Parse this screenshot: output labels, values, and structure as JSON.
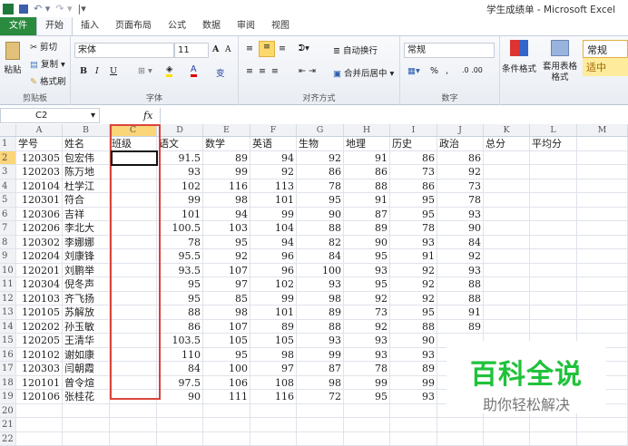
{
  "window": {
    "title": "学生成绩单 - Microsoft Excel"
  },
  "tabs": [
    "文件",
    "开始",
    "插入",
    "页面布局",
    "公式",
    "数据",
    "审阅",
    "视图"
  ],
  "ribbon": {
    "clipboard": {
      "paste": "粘贴",
      "cut": "剪切",
      "copy": "复制",
      "format_painter": "格式刷",
      "label": "剪贴板"
    },
    "font": {
      "name": "宋体",
      "size": "11",
      "bold": "B",
      "italic": "I",
      "underline": "U",
      "label": "字体",
      "grow": "A",
      "shrink": "A",
      "phonetic": "变"
    },
    "alignment": {
      "wrap": "自动换行",
      "merge": "合并后居中",
      "label": "对齐方式"
    },
    "number": {
      "format": "常规",
      "percent": "%",
      "comma": ",",
      "label": "数字"
    },
    "styles": {
      "conditional": "条件格式",
      "table": "套用表格格式",
      "normal": "常规",
      "neutral": "适中"
    }
  },
  "formula_bar": {
    "name_box": "C2",
    "fx": "fx",
    "value": ""
  },
  "columns": [
    "A",
    "B",
    "C",
    "D",
    "E",
    "F",
    "G",
    "H",
    "I",
    "J",
    "K",
    "L",
    "M"
  ],
  "headers": [
    "学号",
    "姓名",
    "班级",
    "语文",
    "数学",
    "英语",
    "生物",
    "地理",
    "历史",
    "政治",
    "总分",
    "平均分",
    ""
  ],
  "rows": [
    [
      "120305",
      "包宏伟",
      "",
      "91.5",
      "89",
      "94",
      "92",
      "91",
      "86",
      "86"
    ],
    [
      "120203",
      "陈万地",
      "",
      "93",
      "99",
      "92",
      "86",
      "86",
      "73",
      "92"
    ],
    [
      "120104",
      "杜学江",
      "",
      "102",
      "116",
      "113",
      "78",
      "88",
      "86",
      "73"
    ],
    [
      "120301",
      "符合",
      "",
      "99",
      "98",
      "101",
      "95",
      "91",
      "95",
      "78"
    ],
    [
      "120306",
      "吉祥",
      "",
      "101",
      "94",
      "99",
      "90",
      "87",
      "95",
      "93"
    ],
    [
      "120206",
      "李北大",
      "",
      "100.5",
      "103",
      "104",
      "88",
      "89",
      "78",
      "90"
    ],
    [
      "120302",
      "李娜娜",
      "",
      "78",
      "95",
      "94",
      "82",
      "90",
      "93",
      "84"
    ],
    [
      "120204",
      "刘康锋",
      "",
      "95.5",
      "92",
      "96",
      "84",
      "95",
      "91",
      "92"
    ],
    [
      "120201",
      "刘鹏举",
      "",
      "93.5",
      "107",
      "96",
      "100",
      "93",
      "92",
      "93"
    ],
    [
      "120304",
      "倪冬声",
      "",
      "95",
      "97",
      "102",
      "93",
      "95",
      "92",
      "88"
    ],
    [
      "120103",
      "齐飞扬",
      "",
      "95",
      "85",
      "99",
      "98",
      "92",
      "92",
      "88"
    ],
    [
      "120105",
      "苏解放",
      "",
      "88",
      "98",
      "101",
      "89",
      "73",
      "95",
      "91"
    ],
    [
      "120202",
      "孙玉敏",
      "",
      "86",
      "107",
      "89",
      "88",
      "92",
      "88",
      "89"
    ],
    [
      "120205",
      "王清华",
      "",
      "103.5",
      "105",
      "105",
      "93",
      "93",
      "90",
      ""
    ],
    [
      "120102",
      "谢如康",
      "",
      "110",
      "95",
      "98",
      "99",
      "93",
      "93",
      ""
    ],
    [
      "120303",
      "闫朝霞",
      "",
      "84",
      "100",
      "97",
      "87",
      "78",
      "89",
      ""
    ],
    [
      "120101",
      "曾令煊",
      "",
      "97.5",
      "106",
      "108",
      "98",
      "99",
      "99",
      ""
    ],
    [
      "120106",
      "张桂花",
      "",
      "90",
      "111",
      "116",
      "72",
      "95",
      "93",
      ""
    ]
  ],
  "empty_rows": [
    20,
    21,
    22
  ],
  "watermark": {
    "title": "百科全说",
    "subtitle": "助你轻松解决"
  },
  "colors": {
    "accent": "#2a8a3e",
    "selection": "#d9443c",
    "watermark": "#1fc23a"
  }
}
